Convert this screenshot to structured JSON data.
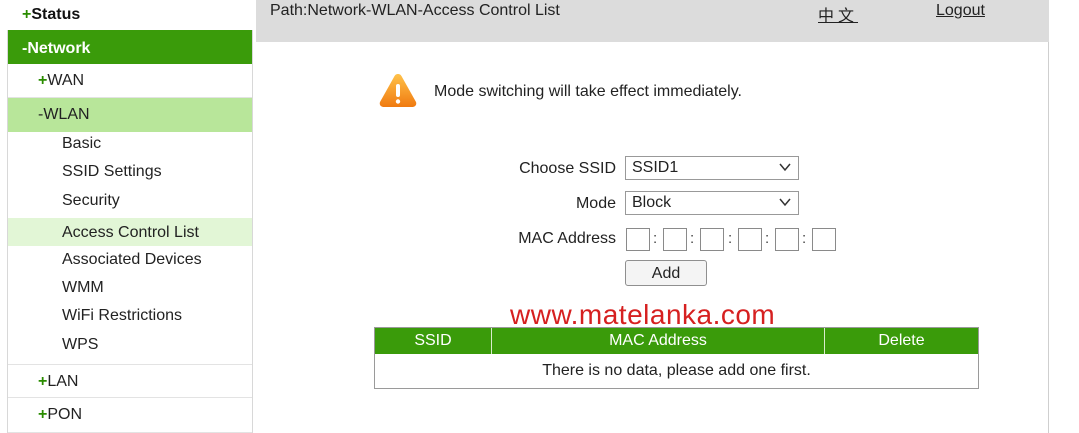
{
  "sidebar": {
    "status": {
      "prefix": "+",
      "label": "Status"
    },
    "network": {
      "prefix": "-",
      "label": "Network"
    },
    "wan": {
      "prefix": "+",
      "label": "WAN"
    },
    "wlan": {
      "prefix": "-",
      "label": "WLAN"
    },
    "wlan_items": [
      "Basic",
      "SSID Settings",
      "Security",
      "Access Control List",
      "Associated Devices",
      "WMM",
      "WiFi Restrictions",
      "WPS"
    ],
    "active_item": "Access Control List",
    "lan": {
      "prefix": "+",
      "label": "LAN"
    },
    "pon": {
      "prefix": "+",
      "label": "PON"
    }
  },
  "header": {
    "path": "Path:Network-WLAN-Access Control List",
    "language": "中文",
    "logout": "Logout"
  },
  "notice": {
    "icon": "warning-icon",
    "text": "Mode switching will take effect immediately."
  },
  "form": {
    "ssid_label": "Choose SSID",
    "ssid_value": "SSID1",
    "mode_label": "Mode",
    "mode_value": "Block",
    "mac_label": "MAC Address",
    "mac_octets": [
      "",
      "",
      "",
      "",
      "",
      ""
    ],
    "add_button": "Add"
  },
  "watermark": "www.matelanka.com",
  "table": {
    "columns": [
      "SSID",
      "MAC Address",
      "Delete"
    ],
    "rows": [],
    "empty_message": "There is no data, please add one first."
  },
  "colors": {
    "accent_green": "#3a9b0a",
    "light_green": "#b8e69a",
    "active_green": "#e2f6d6",
    "header_gray": "#dcdcdc",
    "watermark_red": "#d62020"
  }
}
